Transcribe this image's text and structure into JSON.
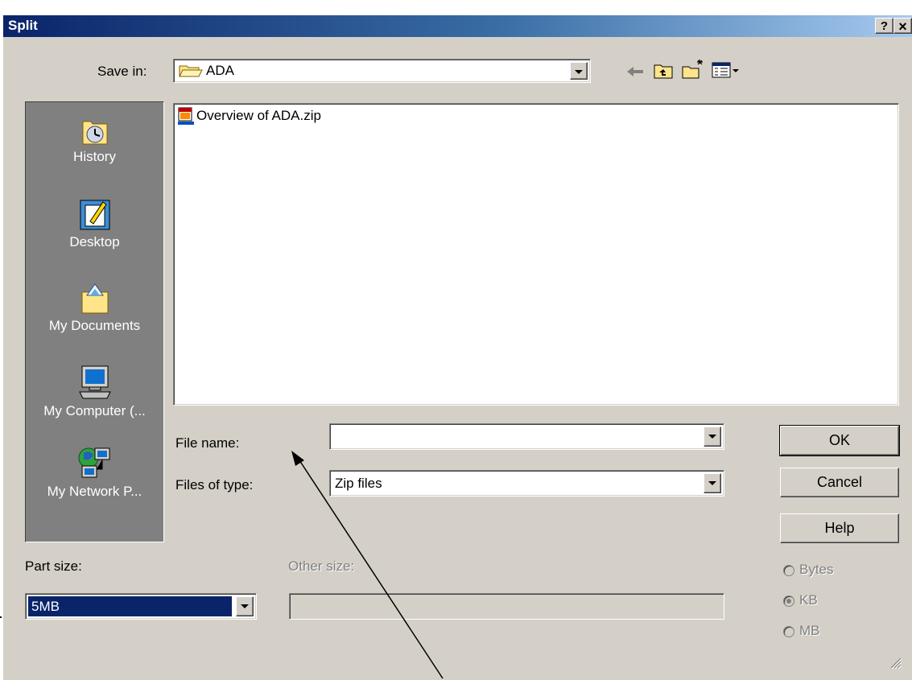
{
  "dialog": {
    "title": "Split",
    "help_button": "?",
    "close_button": "×"
  },
  "save_in": {
    "label": "Save in:",
    "value": "ADA"
  },
  "places": [
    {
      "label": "History",
      "icon": "history-icon"
    },
    {
      "label": "Desktop",
      "icon": "desktop-icon"
    },
    {
      "label": "My Documents",
      "icon": "my-documents-icon"
    },
    {
      "label": "My Computer (...",
      "icon": "my-computer-icon"
    },
    {
      "label": "My Network P...",
      "icon": "my-network-places-icon"
    }
  ],
  "files": [
    {
      "name": "Overview of ADA.zip",
      "icon": "zip-file-icon"
    }
  ],
  "file_name": {
    "label": "File name:",
    "value": ""
  },
  "file_type": {
    "label": "Files of type:",
    "value": "Zip files"
  },
  "buttons": {
    "ok": "OK",
    "cancel": "Cancel",
    "help": "Help"
  },
  "part_size": {
    "label": "Part size:",
    "value": "5MB"
  },
  "other_size": {
    "label": "Other size:",
    "value": ""
  },
  "units": [
    {
      "label": "Bytes",
      "checked": false
    },
    {
      "label": "KB",
      "checked": true
    },
    {
      "label": "MB",
      "checked": false
    }
  ],
  "colors": {
    "titlebar_start": "#0a246a",
    "titlebar_end": "#a6caf0",
    "face": "#d4d0c8",
    "selection": "#0a246a"
  }
}
